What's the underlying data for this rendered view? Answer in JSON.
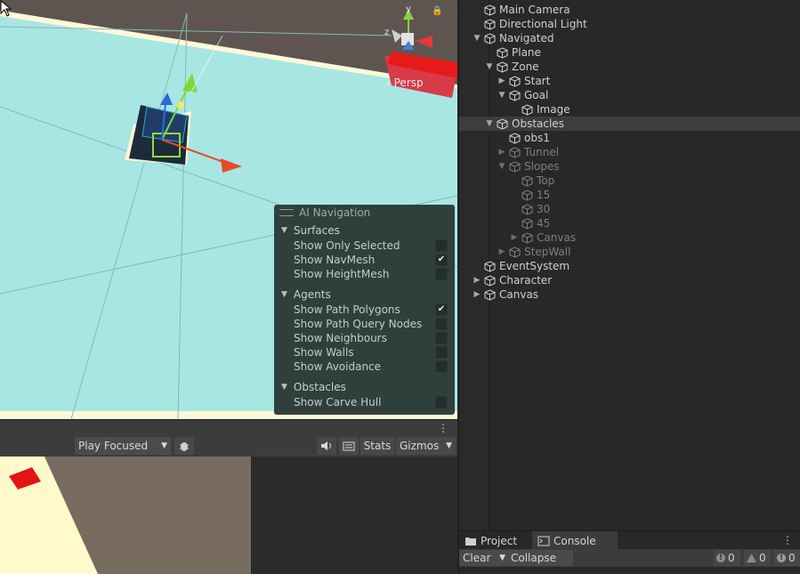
{
  "scene": {
    "persp_label": "Persp",
    "gizmo_y": "y",
    "gizmo_z": "z"
  },
  "ai_navigation": {
    "title": "AI Navigation",
    "sections": [
      {
        "label": "Surfaces",
        "options": [
          {
            "label": "Show Only Selected",
            "checked": false
          },
          {
            "label": "Show NavMesh",
            "checked": true
          },
          {
            "label": "Show HeightMesh",
            "checked": false
          }
        ]
      },
      {
        "label": "Agents",
        "options": [
          {
            "label": "Show Path Polygons",
            "checked": true
          },
          {
            "label": "Show Path Query Nodes",
            "checked": false
          },
          {
            "label": "Show Neighbours",
            "checked": false
          },
          {
            "label": "Show Walls",
            "checked": false
          },
          {
            "label": "Show Avoidance",
            "checked": false
          }
        ]
      },
      {
        "label": "Obstacles",
        "options": [
          {
            "label": "Show Carve Hull",
            "checked": false
          }
        ]
      }
    ]
  },
  "game_toolbar": {
    "play_mode": "Play Focused",
    "stats": "Stats",
    "gizmos": "Gizmos"
  },
  "hierarchy": {
    "items": [
      {
        "name": "Main Camera",
        "depth": 0,
        "arrow": "",
        "dim": false,
        "selected": false
      },
      {
        "name": "Directional Light",
        "depth": 0,
        "arrow": "",
        "dim": false,
        "selected": false
      },
      {
        "name": "Navigated",
        "depth": 0,
        "arrow": "down",
        "dim": false,
        "selected": false
      },
      {
        "name": "Plane",
        "depth": 1,
        "arrow": "",
        "dim": false,
        "selected": false
      },
      {
        "name": "Zone",
        "depth": 1,
        "arrow": "down",
        "dim": false,
        "selected": false
      },
      {
        "name": "Start",
        "depth": 2,
        "arrow": "right",
        "dim": false,
        "selected": false
      },
      {
        "name": "Goal",
        "depth": 2,
        "arrow": "down",
        "dim": false,
        "selected": false
      },
      {
        "name": "Image",
        "depth": 3,
        "arrow": "",
        "dim": false,
        "selected": false
      },
      {
        "name": "Obstacles",
        "depth": 1,
        "arrow": "down",
        "dim": false,
        "selected": true
      },
      {
        "name": "obs1",
        "depth": 2,
        "arrow": "",
        "dim": false,
        "selected": false
      },
      {
        "name": "Tunnel",
        "depth": 2,
        "arrow": "right",
        "dim": true,
        "selected": false
      },
      {
        "name": "Slopes",
        "depth": 2,
        "arrow": "down",
        "dim": true,
        "selected": false
      },
      {
        "name": "Top",
        "depth": 3,
        "arrow": "",
        "dim": true,
        "selected": false
      },
      {
        "name": "15",
        "depth": 3,
        "arrow": "",
        "dim": true,
        "selected": false
      },
      {
        "name": "30",
        "depth": 3,
        "arrow": "",
        "dim": true,
        "selected": false
      },
      {
        "name": "45",
        "depth": 3,
        "arrow": "",
        "dim": true,
        "selected": false
      },
      {
        "name": "Canvas",
        "depth": 3,
        "arrow": "right",
        "dim": true,
        "selected": false
      },
      {
        "name": "StepWall",
        "depth": 2,
        "arrow": "right",
        "dim": true,
        "selected": false
      },
      {
        "name": "EventSystem",
        "depth": 0,
        "arrow": "",
        "dim": false,
        "selected": false
      },
      {
        "name": "Character",
        "depth": 0,
        "arrow": "right",
        "dim": false,
        "selected": false
      },
      {
        "name": "Canvas",
        "depth": 0,
        "arrow": "right",
        "dim": false,
        "selected": false
      }
    ]
  },
  "bottom_tabs": {
    "project": "Project",
    "console": "Console"
  },
  "console_toolbar": {
    "clear": "Clear",
    "collapse": "Collapse",
    "log_count": "0",
    "warn_count": "0",
    "error_count": "0"
  }
}
